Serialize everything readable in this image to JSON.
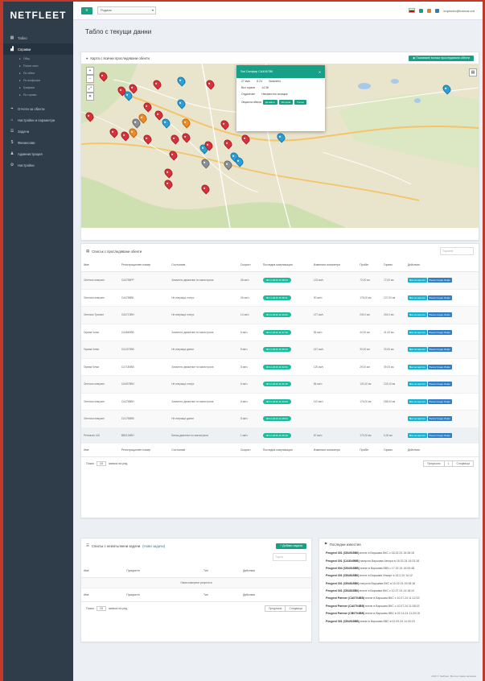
{
  "app": {
    "logo": "NETFLEET"
  },
  "topbar": {
    "menu_icon": "bars-icon",
    "select_value": "Родина",
    "user_email": "kopincev@kotova.ord"
  },
  "sidebar": {
    "items": [
      {
        "label": "Табло",
        "icon": "dashboard-icon"
      },
      {
        "label": "Справки",
        "icon": "chart-icon"
      },
      {
        "label": "Отчети за обекти",
        "icon": "marker-icon"
      },
      {
        "label": "Настройки и параметри",
        "icon": "map-icon"
      },
      {
        "label": "Задачи",
        "icon": "tasks-icon"
      },
      {
        "label": "Финансови",
        "icon": "money-icon"
      },
      {
        "label": "Администрация",
        "icon": "admin-icon"
      },
      {
        "label": "Настройки",
        "icon": "gear-icon"
      }
    ],
    "subitems": [
      {
        "label": "Общ"
      },
      {
        "label": "Пътни лист"
      },
      {
        "label": "По обект"
      },
      {
        "label": "По шофьори"
      },
      {
        "label": "Графики"
      },
      {
        "label": "По гориво"
      }
    ]
  },
  "page": {
    "title": "Табло с текущи данни"
  },
  "map_panel": {
    "title": "Карта с всички проследявани обекти",
    "button": "Показване всички проследявани обекти",
    "popup": {
      "title": "Sat Сапфир СА4067ВК",
      "row1": [
        "27 км/ч",
        "8.24",
        "Запалено"
      ],
      "row2": [
        "Вкл горене",
        "14.38"
      ],
      "row3": [
        "Отдалечен",
        "Неизвестно позиция"
      ],
      "btn_label": "Опции на обекта",
      "btns": [
        "Детайли",
        "История",
        "Пътни"
      ]
    }
  },
  "objects_panel": {
    "title": "Списък с проследявани обекти",
    "search_placeholder": "Търсене",
    "columns": [
      "Име",
      "Регистрационен номер",
      "Състояние",
      "Скорост",
      "Последна комуникация",
      "Изминати километри",
      "Пробег",
      "Гориво",
      "Действия"
    ],
    "rows": [
      [
        "Опелски лимузин",
        "СА4786РР",
        "Запалено движение по магистрала",
        "36 км/ч",
        "08.11.2016 11:38:34",
        "123 км/ч",
        "72,00 км",
        "72,00 км"
      ],
      [
        "Опелски лимузин",
        "СА4788ВК",
        "Не изпраща статус",
        "46 км/ч",
        "08.11.2016 11:38:11",
        "90 км/ч",
        "178,00 км",
        "137,00 км"
      ],
      [
        "Опелски Транзит",
        "СА4713ВН",
        "Не изпраща статус",
        "14 км/ч",
        "08.11.2016 11:36:02",
        "127 км/ч",
        "244,0 км",
        "244,0 км"
      ],
      [
        "Гарваа Чеми",
        "СА4860ВВ",
        "Запалено движение по магистрала",
        "6 км/ч",
        "08.11.2016 11:37:10",
        "84 км/ч",
        "44,00 км",
        "41,00 км"
      ],
      [
        "Гарваа Чеми",
        "СА1370ВВ",
        "Не изпраща данни",
        "8 км/ч",
        "08.11.2016 11:35:40",
        "167 км/ч",
        "33,00 км",
        "33,00 км"
      ],
      [
        "Гарваа Чеми",
        "СА7180ВВ",
        "Запалено движение по магистрала",
        "8 км/ч",
        "08.11.2016 11:32:21",
        "120 км/ч",
        "29,00 км",
        "39,00 км"
      ],
      [
        "Опелски лимузин",
        "СА4578ВН",
        "Не изпраща статус",
        "6 км/ч",
        "08.11.2016 11:31:15",
        "84 км/ч",
        "133,10 км",
        "133,10 км"
      ],
      [
        "Опелски лимузин",
        "СА4788ВН",
        "Запалено движение по магистрала",
        "8 км/ч",
        "08.11.2016 11:30:33",
        "110 км/ч",
        "176,00 км",
        "188,00 км"
      ],
      [
        "Опелски лимузин",
        "СА1785ВВ",
        "Не изпраща данни",
        "8 км/ч",
        "08.11.2016 11:28:44",
        "",
        "",
        ""
      ]
    ],
    "total_row": [
      "Регионал 140",
      "ВВ2100ВН",
      "Бягаш двигател по магистрала",
      "1 км/ч",
      "08.11.2016 11:25:18",
      "87 км/ч",
      "172,00 км",
      "0,00 км"
    ],
    "footer_cols": [
      "Име",
      "Регистрационен номер",
      "Състояние",
      "Скорост",
      "Последна комуникация",
      "Изминати километри",
      "Пробег",
      "Гориво",
      "Действия"
    ],
    "action_labels": [
      "Виж на картата",
      "Възла Следв. Инфо"
    ],
    "show_label": "Показ",
    "per_page": "15",
    "entries_label": "записа на ред",
    "pager": [
      "Предишна",
      "1",
      "Следваща"
    ]
  },
  "tasks_panel": {
    "title": "Списък с неизпълнени задачи",
    "title_link": "(Нови задачи)",
    "add_button": "+ Добави задача",
    "search_placeholder": "Търси",
    "columns": [
      "Име",
      "Приоритет",
      "Тип",
      "Действия"
    ],
    "empty_text": "Няма намерени резултати",
    "footer_cols": [
      "Име",
      "Приоритет",
      "Тип",
      "Действия"
    ],
    "show_label": "Показ",
    "per_page": "15",
    "entries_label": "записа на ред",
    "pager": [
      "Предишна",
      "Следваща"
    ]
  },
  "notifications": {
    "title": "Последни известия",
    "items": [
      {
        "vehicle": "Peugeot 301 (СВ4918ВК)",
        "text": "влезе в Варшава ВКС с 18.02.24 15:28:18"
      },
      {
        "vehicle": "Peugeot 301 (СА3049ВВ)",
        "text": "напусна Варшава Автора в 18.02.24 15:23:18"
      },
      {
        "vehicle": "Peugeot 904 (СВ4918ВВ)",
        "text": "влезе в Варшава ВВ5 с 17.02.24 16:00:48"
      },
      {
        "vehicle": "Peugeot 301 (СВ4818ВК)",
        "text": "влезе в Варшава Инкарт в 15.2.24 14:12"
      },
      {
        "vehicle": "Peugeot 301 (СВ4818ВК)",
        "text": "напусна Варшава ВКС в 15.02.24 15:28:18"
      },
      {
        "vehicle": "Peugeot 301 (СВ4818ВК)",
        "text": "влезе в Варшава ВКС с 12.07.24 14:18:10"
      },
      {
        "vehicle": "Peugeot Partner (СА0704ВВ)",
        "text": "влезе в Варшава ВКС с 10.07.24 11:12:33"
      },
      {
        "vehicle": "Peugeot Partner (СА0704ВВ)",
        "text": "влезе в Варшава ВКС с 10.07.24 11:08:15"
      },
      {
        "vehicle": "Peugeot Partner (СВ0704ВВ)",
        "text": "влезе в Варшава ВВС в 02.14.24 11:20:18"
      },
      {
        "vehicle": "Peugeot 301 (СВ4918ВВ)",
        "text": "влезе в Варшава ВВС в 02.09.24 14:30:15"
      }
    ]
  },
  "footer": {
    "text": "2016 © NetFleet. Всички права запазени"
  }
}
